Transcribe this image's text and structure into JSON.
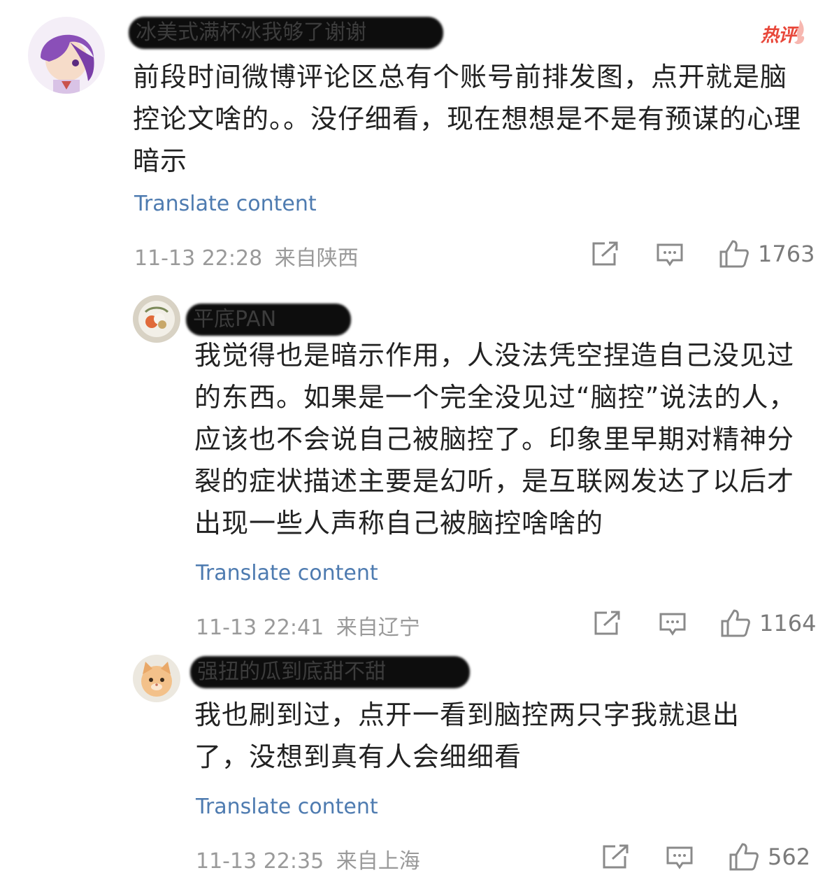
{
  "comments": [
    {
      "username": "冰美式满杯冰我够了谢谢",
      "badge": "热评",
      "text": "前段时间微博评论区总有个账号前排发图，点开就是脑控论文啥的。。没仔细看，现在想想是不是有预谋的心理暗示",
      "translate_label": "Translate content",
      "time": "11-13 22:28",
      "location": "来自陕西",
      "likes": "1763"
    },
    {
      "username": "平底PAN",
      "text": "我觉得也是暗示作用，人没法凭空捏造自己没见过的东西。如果是一个完全没见过“脑控”说法的人，应该也不会说自己被脑控了。印象里早期对精神分裂的症状描述主要是幻听，是互联网发达了以后才出现一些人声称自己被脑控啥啥的",
      "translate_label": "Translate content",
      "time": "11-13 22:41",
      "location": "来自辽宁",
      "likes": "1164"
    },
    {
      "username": "强扭的瓜到底甜不甜",
      "text": "我也刷到过，点开一看到脑控两只字我就退出了，没想到真有人会细细看",
      "translate_label": "Translate content",
      "time": "11-13 22:35",
      "location": "来自上海",
      "likes": "562"
    }
  ],
  "icons": {
    "share": "share-icon",
    "comment": "comment-icon",
    "like": "thumbs-up-icon"
  },
  "colors": {
    "link": "#4e7bb0",
    "meta": "#9a9a9a",
    "hot": "#e8473a"
  }
}
